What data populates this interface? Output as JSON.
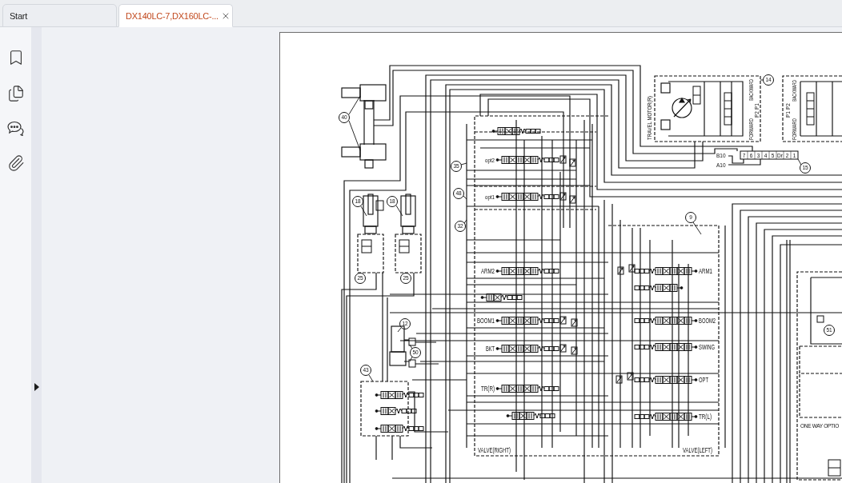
{
  "tabs": [
    {
      "label": "Start",
      "selected": false,
      "closable": false
    },
    {
      "label": "DX140LC-7,DX160LC-...",
      "selected": true,
      "closable": true
    }
  ],
  "schematic": {
    "valve_right": {
      "title": "VALVE(RIGHT)",
      "spools": [
        "opt2",
        "opt1",
        "ARM2",
        "BOOM1",
        "BKT",
        "TR(R)"
      ]
    },
    "valve_left": {
      "title": "VALVE(LEFT)",
      "spools": [
        "ARM1",
        "BOOM2",
        "SWING",
        "OPT",
        "TR(L)"
      ]
    },
    "travel_motor": {
      "title": "TRAVEL MOTOR(R)",
      "directions": [
        "BACKWARD",
        "FORWARD"
      ],
      "ports": [
        "P1",
        "P2"
      ]
    },
    "second_motor": {
      "directions": [
        "BACKWARD",
        "FORWARD"
      ],
      "ports": [
        "P2",
        "P1"
      ]
    },
    "connector": {
      "pins": [
        "7",
        "6",
        "3",
        "4",
        "5",
        "Dr",
        "2",
        "1"
      ],
      "wires": [
        "B10",
        "A10"
      ]
    },
    "option_box": {
      "title": "ONE WAY OPTIO"
    },
    "callouts": [
      "40",
      "14",
      "18",
      "18",
      "35",
      "15",
      "48",
      "9",
      "32",
      "25",
      "25",
      "12",
      "51",
      "50",
      "43"
    ]
  }
}
